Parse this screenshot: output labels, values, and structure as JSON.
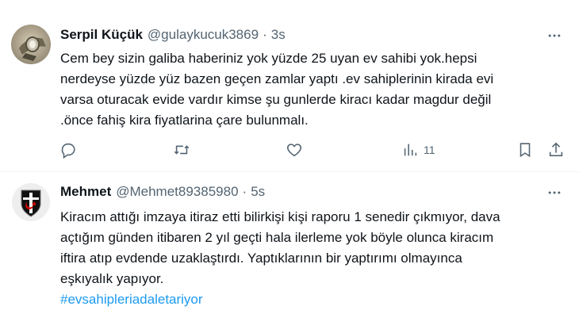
{
  "tweets": [
    {
      "name": "Serpil Küçük",
      "handle": "@gulaykucuk3869",
      "dot": "·",
      "time": "3s",
      "lines": [
        "Cem bey sizin galiba haberiniz yok yüzde 25 uyan ev sahibi yok.hepsi",
        "nerdeyse yüzde yüz bazen geçen zamlar yaptı .ev sahiplerinin kirada evi",
        "varsa oturacak evide vardır kimse şu gunlerde kiracı kadar magdur değil",
        ".önce fahiş kira fiyatlarina çare bulunmalı."
      ],
      "actions": {
        "views_count": "11"
      }
    },
    {
      "name": "Mehmet",
      "handle": "@Mehmet89385980",
      "dot": "·",
      "time": "5s",
      "lines": [
        "Kiracım attığı imzaya itiraz etti bilirkişi kişi raporu 1 senedir çıkmıyor, dava",
        "açtığım günden itibaren 2 yıl geçti hala ilerleme yok böyle olunca kiracım",
        "iftira atıp evdende uzaklaştırdı. Yaptıklarının bir yaptırımı olmayınca",
        "eşkıyalık yapıyor."
      ],
      "hashtag": "#evsahipleriadaletariyor"
    }
  ],
  "icons": {
    "more": "more-horizontal-icon",
    "reply": "reply-icon",
    "retweet": "retweet-icon",
    "like": "heart-icon",
    "views": "views-chart-icon",
    "bookmark": "bookmark-icon",
    "share": "share-icon"
  },
  "colors": {
    "text": "#0f1419",
    "secondary": "#536471",
    "link": "#1d9bf0",
    "divider": "#eff3f4"
  }
}
